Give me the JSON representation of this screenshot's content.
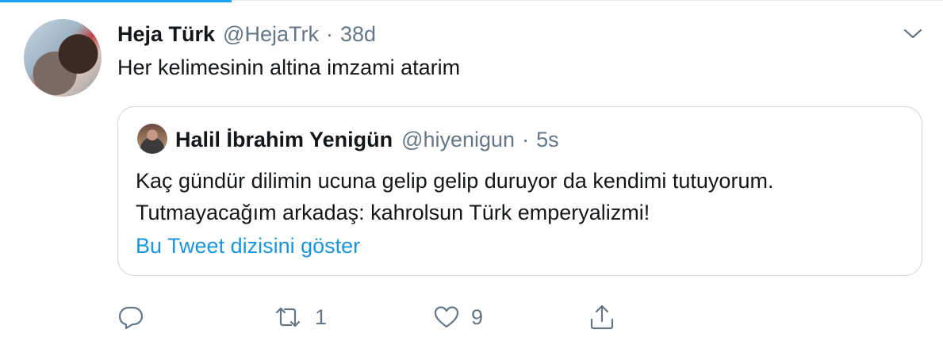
{
  "tweet": {
    "author_name": "Heja Türk",
    "author_handle": "@HejaTrk",
    "separator": "·",
    "time": "38d",
    "text": "Her kelimesinin altina imzami atarim"
  },
  "quoted_tweet": {
    "author_name": "Halil İbrahim Yenigün",
    "author_handle": "@hiyenigun",
    "separator": "·",
    "time": "5s",
    "text_lines": [
      "Kaç gündür dilimin ucuna gelip gelip duruyor da kendimi tutuyorum.",
      "Tutmayacağım arkadaş: kahrolsun Türk emperyalizmi!"
    ],
    "show_thread_link": "Bu Tweet dizisini göster"
  },
  "actions": {
    "reply_icon": "reply-icon",
    "retweet_icon": "retweet-icon",
    "retweet_count": "1",
    "like_icon": "heart-icon",
    "like_count": "9",
    "share_icon": "share-icon"
  },
  "colors": {
    "accent": "#1da1f2",
    "link": "#1b95e0",
    "secondary_text": "#657786",
    "border": "#ccd6dd"
  }
}
